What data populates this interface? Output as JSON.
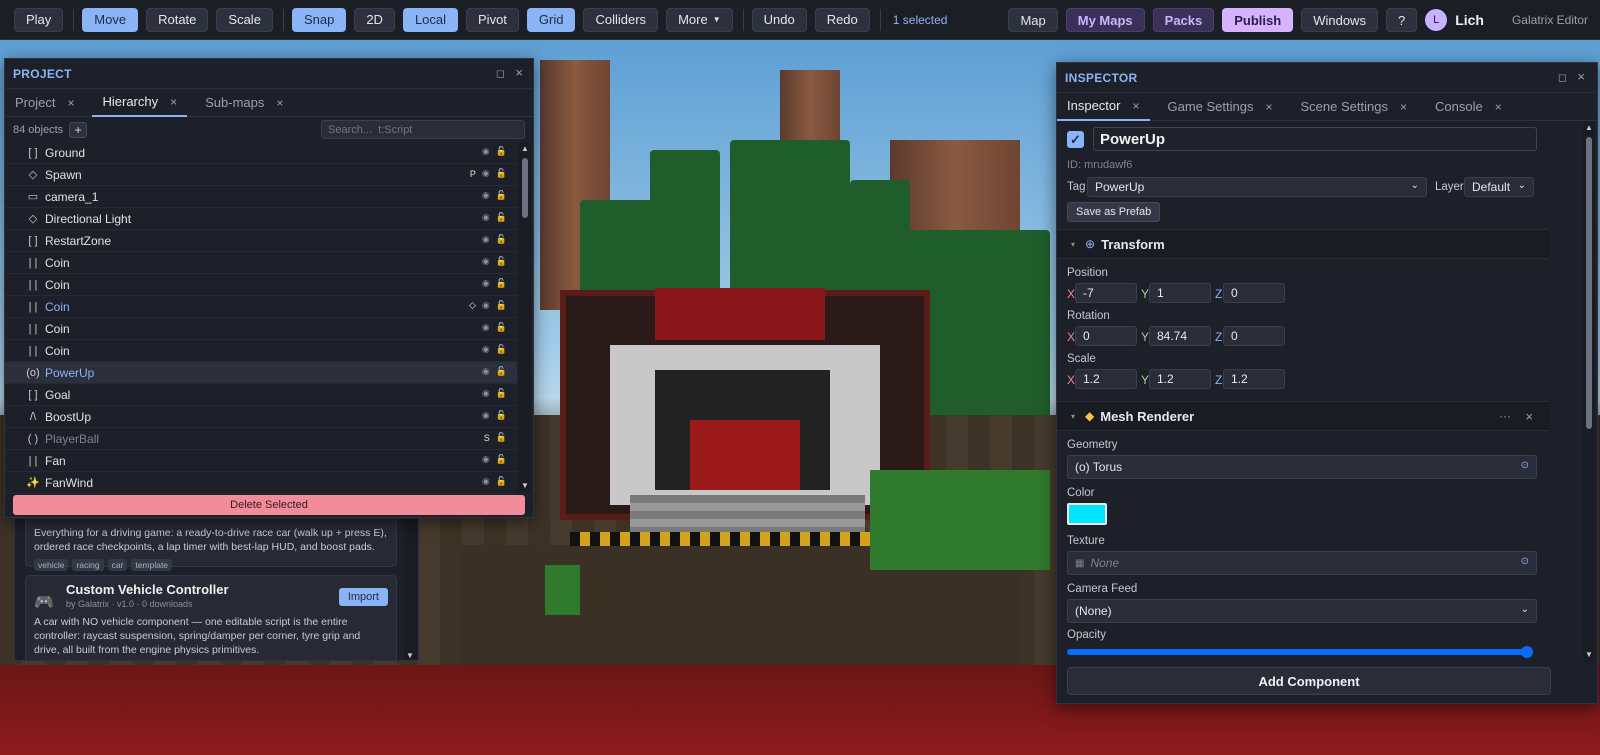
{
  "toolbar": {
    "play": "Play",
    "move": "Move",
    "rotate": "Rotate",
    "scale": "Scale",
    "snap": "Snap",
    "twod": "2D",
    "local": "Local",
    "pivot": "Pivot",
    "grid": "Grid",
    "colliders": "Colliders",
    "more": "More",
    "undo": "Undo",
    "redo": "Redo",
    "selected": "1 selected",
    "map": "Map",
    "my_maps": "My Maps",
    "packs": "Packs",
    "publish": "Publish",
    "windows": "Windows",
    "help": "?",
    "avatar_initial": "L",
    "username": "Lich",
    "app_name": "Galatrix Editor"
  },
  "project_panel": {
    "title": "PROJECT",
    "tabs": [
      {
        "label": "Project"
      },
      {
        "label": "Hierarchy"
      },
      {
        "label": "Sub-maps"
      }
    ],
    "object_count": "84 objects",
    "add": "+",
    "search_placeholder": "Search...  t:Script",
    "items": [
      {
        "icon": "[ ]",
        "name": "Ground",
        "flag": ""
      },
      {
        "icon": "◇",
        "name": "Spawn",
        "flag": "P"
      },
      {
        "icon": "▭",
        "name": "camera_1",
        "flag": ""
      },
      {
        "icon": "◇",
        "name": "Directional Light",
        "flag": ""
      },
      {
        "icon": "[ ]",
        "name": "RestartZone",
        "flag": ""
      },
      {
        "icon": "| |",
        "name": "Coin",
        "flag": ""
      },
      {
        "icon": "| |",
        "name": "Coin",
        "flag": ""
      },
      {
        "icon": "| |",
        "name": "Coin",
        "flag": "◇"
      },
      {
        "icon": "| |",
        "name": "Coin",
        "flag": ""
      },
      {
        "icon": "| |",
        "name": "Coin",
        "flag": ""
      },
      {
        "icon": "(o)",
        "name": "PowerUp",
        "flag": ""
      },
      {
        "icon": "[ ]",
        "name": "Goal",
        "flag": ""
      },
      {
        "icon": "/\\",
        "name": "BoostUp",
        "flag": ""
      },
      {
        "icon": "( )",
        "name": "PlayerBall",
        "flag": "S"
      },
      {
        "icon": "| |",
        "name": "Fan",
        "flag": ""
      },
      {
        "icon": "✨",
        "name": "FanWind",
        "flag": ""
      }
    ],
    "delete_label": "Delete Selected"
  },
  "packs_panel": {
    "card1": {
      "description": "Everything for a driving game: a ready-to-drive race car (walk up + press E), ordered race checkpoints, a lap timer with best-lap HUD, and boost pads.",
      "tags": [
        "vehicle",
        "racing",
        "car",
        "template"
      ]
    },
    "card2": {
      "title": "Custom Vehicle Controller",
      "byline": "by Galatrix · v1.0 · 0 downloads",
      "import": "Import",
      "description": "A car with NO vehicle component — one editable script is the entire controller: raycast suspension, spring/damper per corner, tyre grip and drive, all built from the engine physics primitives."
    }
  },
  "inspector": {
    "title": "INSPECTOR",
    "tabs": [
      {
        "label": "Inspector"
      },
      {
        "label": "Game Settings"
      },
      {
        "label": "Scene Settings"
      },
      {
        "label": "Console"
      }
    ],
    "name": "PowerUp",
    "id": "ID: mrudawf6",
    "tag_label": "Tag",
    "tag_value": "PowerUp",
    "layer_label": "Layer",
    "layer_value": "Default",
    "save_prefab": "Save as Prefab",
    "transform": {
      "title": "Transform",
      "position_label": "Position",
      "position": {
        "x": "-7",
        "y": "1",
        "z": "0"
      },
      "rotation_label": "Rotation",
      "rotation": {
        "x": "0",
        "y": "84.74",
        "z": "0"
      },
      "scale_label": "Scale",
      "scale": {
        "x": "1.2",
        "y": "1.2",
        "z": "1.2"
      }
    },
    "mesh_renderer": {
      "title": "Mesh Renderer",
      "more": "···",
      "close": "×",
      "geometry_label": "Geometry",
      "geometry_value": "(o) Torus",
      "color_label": "Color",
      "color_value": "#00e5ff",
      "texture_label": "Texture",
      "texture_value": "None",
      "camera_feed_label": "Camera Feed",
      "camera_feed_value": "(None)",
      "opacity_label": "Opacity",
      "opacity_value": 1.0
    },
    "add_component": "Add Component"
  }
}
